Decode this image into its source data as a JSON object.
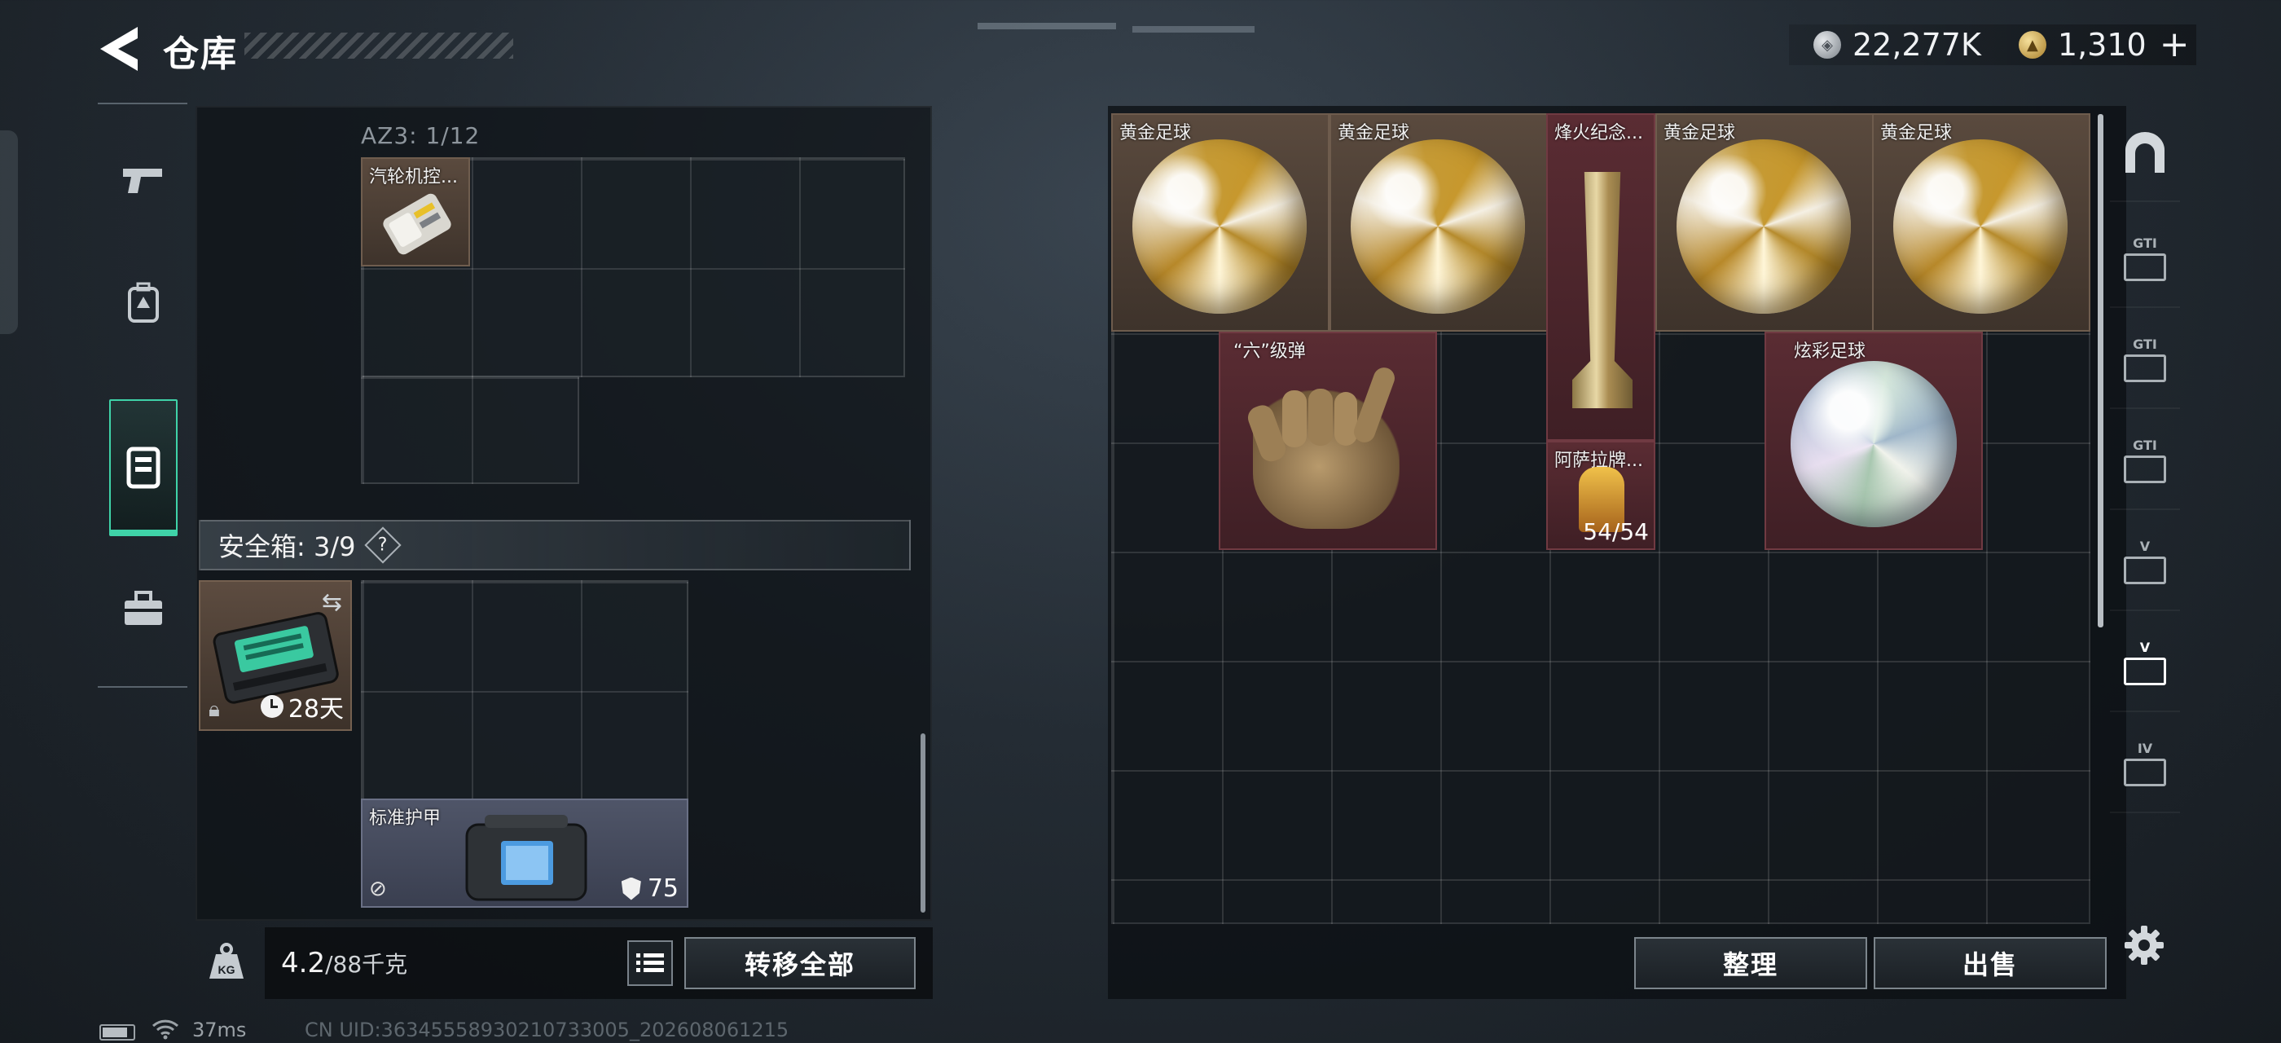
{
  "header": {
    "title": "仓库",
    "currency": {
      "silver_amount": "22,277K",
      "gold_amount": "1,310",
      "add_label": "+"
    }
  },
  "left_tabs": [
    {
      "icon": "pistol-icon",
      "active": false
    },
    {
      "icon": "backpack-icon",
      "active": false
    },
    {
      "icon": "vest-icon",
      "active": true
    },
    {
      "icon": "toolbox-icon",
      "active": false
    }
  ],
  "backpack": {
    "container_label": "AZ3: 1/12",
    "items": [
      {
        "name": "汽轮机控...",
        "rarity": "gold"
      }
    ]
  },
  "safebox": {
    "label": "安全箱: 3/9",
    "help_label": "?",
    "timer_label": "28天",
    "armor": {
      "name": "标准护甲",
      "durability": "75"
    }
  },
  "footer_left": {
    "weight_current": "4.2",
    "weight_max": "/88千克",
    "transfer_all_label": "转移全部"
  },
  "storage": {
    "items": [
      {
        "name": "黄金足球",
        "rarity": "gold"
      },
      {
        "name": "黄金足球",
        "rarity": "gold"
      },
      {
        "name": "烽火纪念...",
        "rarity": "red"
      },
      {
        "name": "黄金足球",
        "rarity": "gold"
      },
      {
        "name": "黄金足球",
        "rarity": "gold"
      },
      {
        "name": "“六”级弹",
        "rarity": "red"
      },
      {
        "name": "炫彩足球",
        "rarity": "red"
      },
      {
        "name": "阿萨拉牌...",
        "rarity": "red",
        "count": "54/54"
      }
    ],
    "sort_label": "整理",
    "sell_label": "出售"
  },
  "right_tabs": [
    {
      "label": "",
      "icon": "arch-icon"
    },
    {
      "label": "GTI",
      "icon": "gti-box-icon"
    },
    {
      "label": "GTI",
      "icon": "gti-warning-icon"
    },
    {
      "label": "GTI",
      "icon": "gti-card-icon"
    },
    {
      "label": "V",
      "icon": "v-box-icon"
    },
    {
      "label": "V",
      "icon": "v-box-active-icon",
      "active": true
    },
    {
      "label": "IV",
      "icon": "iv-add-icon"
    }
  ],
  "status": {
    "ping": "37ms",
    "uid": "CN UID:36345558930210733005_202608061215"
  },
  "colors": {
    "accent": "#3fd3a8",
    "gold_rarity": "#5a4a3e",
    "red_rarity": "#5a2c33"
  }
}
